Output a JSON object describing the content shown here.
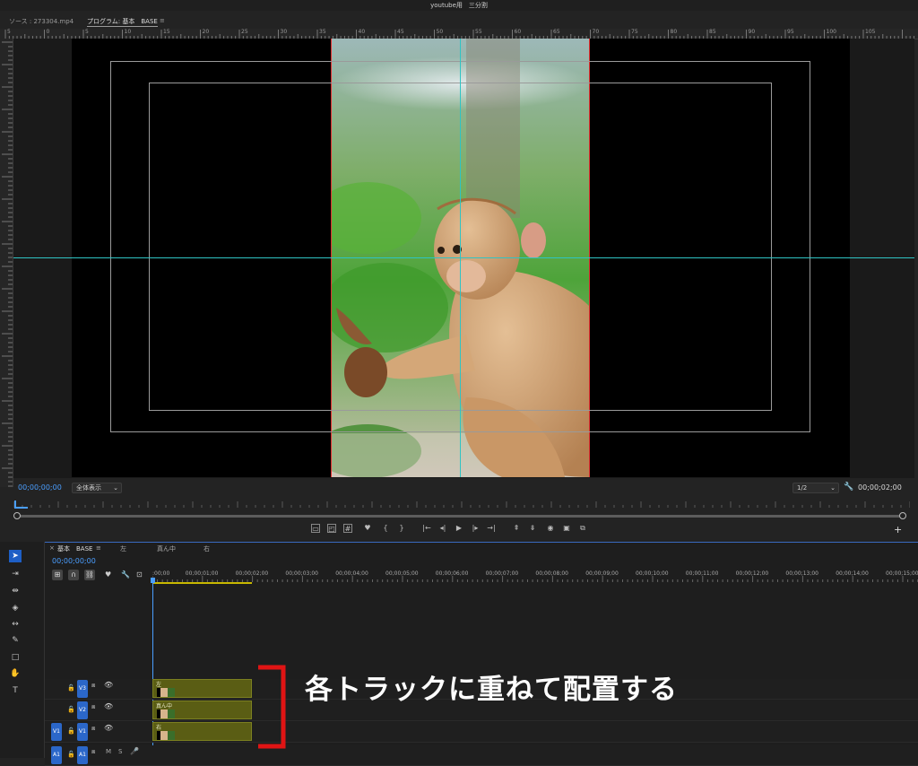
{
  "window": {
    "title": "youtube用　三分割"
  },
  "source_tab": {
    "label": "ソース : 273304.mp4"
  },
  "program_tab": {
    "label": "プログラム: 基本　BASE",
    "menu": "≡"
  },
  "ruler": {
    "labels": [
      "5",
      "0",
      "5",
      "10",
      "15",
      "20",
      "25",
      "30",
      "35",
      "40",
      "45",
      "50",
      "55",
      "60",
      "65",
      "70",
      "75",
      "80",
      "85",
      "90",
      "95",
      "100",
      "105"
    ]
  },
  "program": {
    "timecode_current": "00;00;00;00",
    "zoom": "全体表示",
    "resolution": "1/2",
    "timecode_duration": "00;00;02;00"
  },
  "transport": {
    "buttons": [
      {
        "name": "safe-margins-icon",
        "glyph": "▭"
      },
      {
        "name": "overlay-icon",
        "glyph": "◰"
      },
      {
        "name": "guides-icon",
        "glyph": "#"
      },
      {
        "name": "marker-icon",
        "glyph": "♥"
      },
      {
        "name": "mark-in-icon",
        "glyph": "{"
      },
      {
        "name": "mark-out-icon",
        "glyph": "}"
      },
      {
        "name": "go-to-in-icon",
        "glyph": "|←"
      },
      {
        "name": "step-back-icon",
        "glyph": "◂|"
      },
      {
        "name": "play-icon",
        "glyph": "▶"
      },
      {
        "name": "step-forward-icon",
        "glyph": "|▸"
      },
      {
        "name": "go-to-out-icon",
        "glyph": "→|"
      },
      {
        "name": "lift-icon",
        "glyph": "⇞"
      },
      {
        "name": "extract-icon",
        "glyph": "⇟"
      },
      {
        "name": "export-frame-icon",
        "glyph": "◉"
      },
      {
        "name": "comparison-view-icon",
        "glyph": "▣"
      },
      {
        "name": "proxy-toggle-icon",
        "glyph": "⧉"
      }
    ],
    "add_button": "+"
  },
  "timeline": {
    "sequence_tab": "基本　BASE",
    "tab_close": "×",
    "tab_menu": "≡",
    "other_tabs": [
      "左",
      "真ん中",
      "右"
    ],
    "timecode": "00;00;00;00",
    "ruler_labels": [
      ":00;00",
      "00;00;01;00",
      "00;00;02;00",
      "00;00;03;00",
      "00;00;04;00",
      "00;00;05;00",
      "00;00;06;00",
      "00;00;07;00",
      "00;00;08;00",
      "00;00;09;00",
      "00;00;10;00",
      "00;00;11;00",
      "00;00;12;00",
      "00;00;13;00",
      "00;00;14;00",
      "00;00;15;00"
    ],
    "tracks": [
      {
        "id": "V3",
        "source": "",
        "clip": "左"
      },
      {
        "id": "V2",
        "source": "",
        "clip": "真ん中"
      },
      {
        "id": "V1",
        "source": "V1",
        "clip": "右"
      },
      {
        "id": "A1",
        "source": "A1",
        "m": "M",
        "s": "S",
        "clip": ""
      }
    ]
  },
  "annotation": {
    "text": "各トラックに重ねて配置する",
    "bracket_color": "#e01414"
  },
  "colors": {
    "accent_blue": "#4a9eff",
    "guide_cyan": "#2fc4c4",
    "clip_olive": "#5a5d14"
  }
}
